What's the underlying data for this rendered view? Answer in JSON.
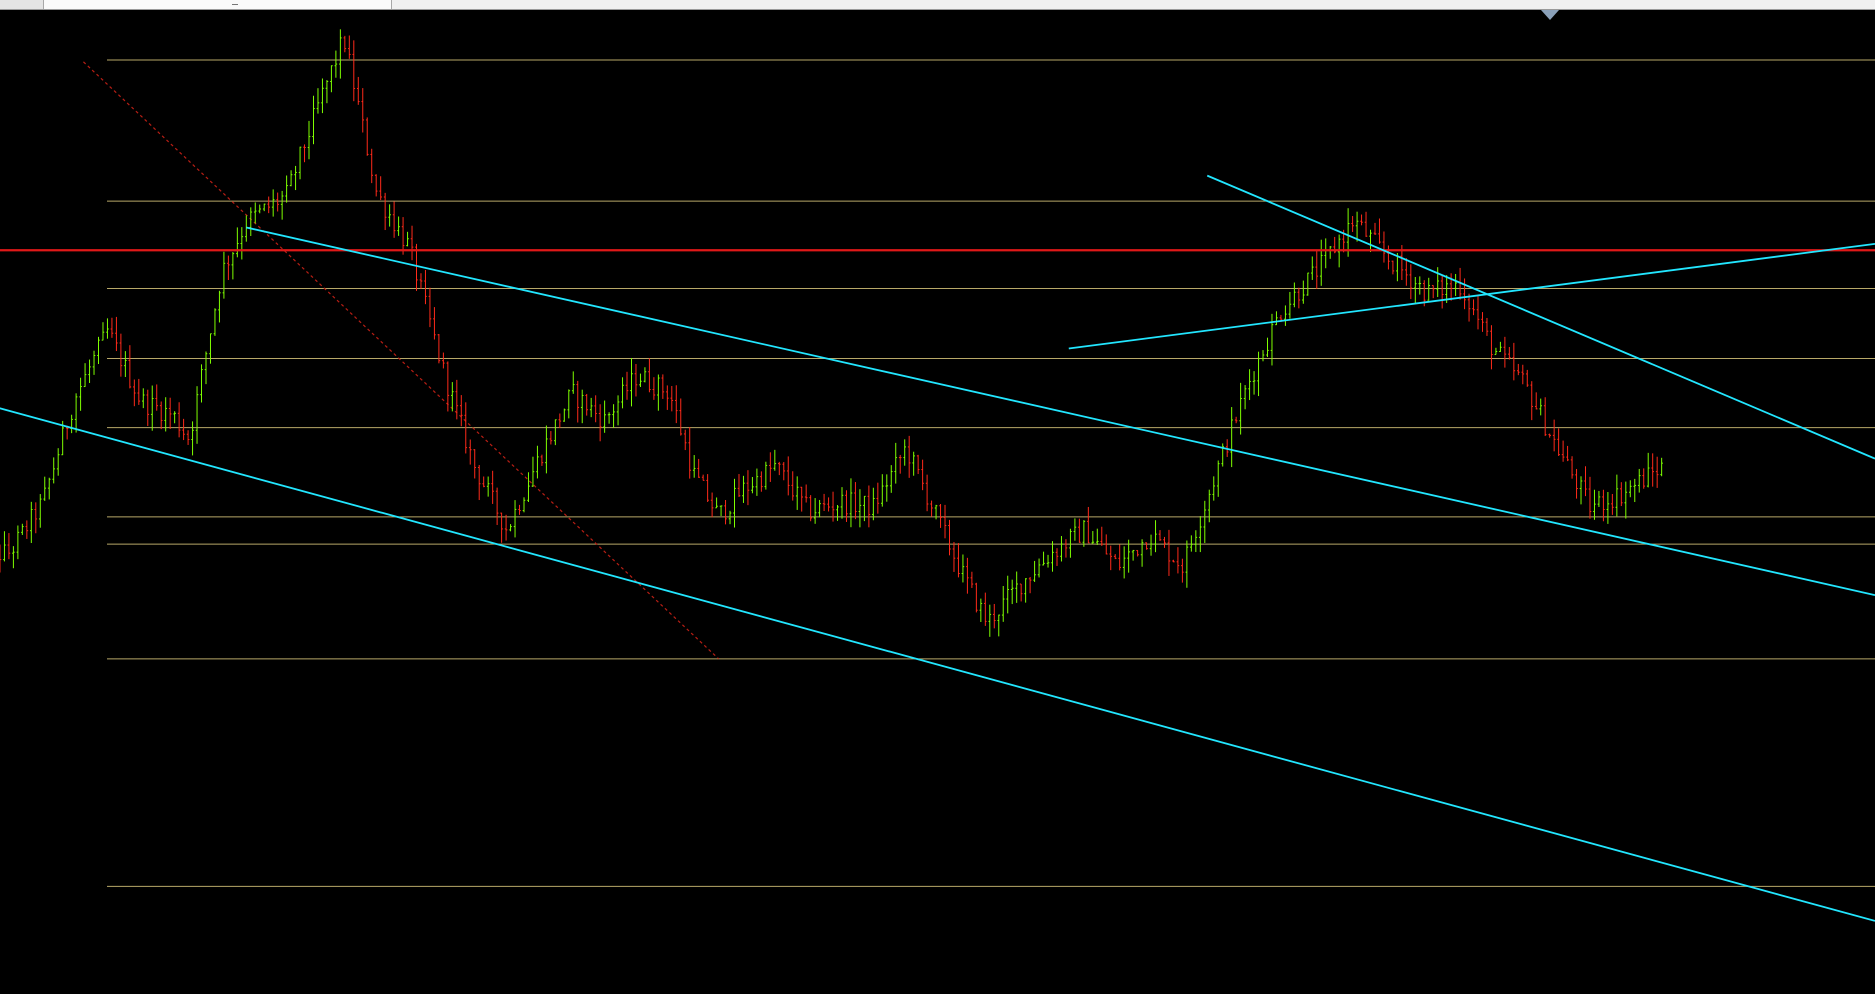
{
  "window": {
    "tabs": [
      "",
      ""
    ],
    "background": "#000000"
  },
  "colors": {
    "bull_candle": "#7fff00",
    "bear_candle": "#ff2a1a",
    "level_line": "#b8a868",
    "trendline": "#22e6ff",
    "key_level": "#e01818",
    "dashed_diagonal": "#b81e14"
  },
  "icons": {
    "scroll_marker": "down-triangle-icon"
  },
  "chart_data": {
    "type": "candlestick",
    "title": "",
    "xlabel": "",
    "ylabel": "",
    "grid": false,
    "legend": "none",
    "ylim": [
      0,
      100
    ],
    "horizontal_levels": [
      95.6,
      80.1,
      70.5,
      62.8,
      55.2,
      45.4,
      42.4,
      29.8,
      4.8
    ],
    "key_level": 74.7,
    "trendlines": [
      {
        "name": "",
        "points": [
          [
            -3,
            58
          ],
          [
            230,
            1
          ]
        ]
      },
      {
        "name": "",
        "points": [
          [
            30,
            77.2
          ],
          [
            230,
            36.8
          ]
        ]
      },
      {
        "name": "",
        "points": [
          [
            131,
            63.9
          ],
          [
            230,
            75.4
          ]
        ]
      },
      {
        "name": "",
        "points": [
          [
            148,
            82.9
          ],
          [
            230,
            51.8
          ]
        ]
      }
    ],
    "dashed_lines": [
      {
        "name": "",
        "points": [
          [
            10,
            95.4
          ],
          [
            88,
            29.8
          ]
        ]
      }
    ],
    "series": [
      {
        "name": "",
        "points": [
          [
            -3,
            41.0
          ],
          [
            1,
            41.5
          ],
          [
            5,
            47.0
          ],
          [
            9,
            58.6
          ],
          [
            13,
            65.8
          ],
          [
            17,
            58.2
          ],
          [
            21,
            56.6
          ],
          [
            23,
            54.0
          ],
          [
            27,
            72.3
          ],
          [
            30,
            77.8
          ],
          [
            35,
            80.8
          ],
          [
            39,
            91.0
          ],
          [
            42,
            98.0
          ],
          [
            46,
            81.0
          ],
          [
            50,
            75.0
          ],
          [
            54,
            62.0
          ],
          [
            58,
            51.0
          ],
          [
            62,
            44.0
          ],
          [
            66,
            52.0
          ],
          [
            70,
            59.0
          ],
          [
            74,
            56.0
          ],
          [
            78,
            61.0
          ],
          [
            82,
            59.0
          ],
          [
            85,
            50.0
          ],
          [
            88,
            45.5
          ],
          [
            91,
            48.4
          ],
          [
            95,
            51.0
          ],
          [
            99,
            46.0
          ],
          [
            103,
            47.0
          ],
          [
            107,
            46.5
          ],
          [
            111,
            53.0
          ],
          [
            115,
            45.0
          ],
          [
            118,
            39.0
          ],
          [
            121,
            33.8
          ],
          [
            125,
            38.0
          ],
          [
            129,
            41.5
          ],
          [
            133,
            44.0
          ],
          [
            137,
            40.0
          ],
          [
            141,
            43.5
          ],
          [
            145,
            40.0
          ],
          [
            149,
            50.0
          ],
          [
            153,
            60.0
          ],
          [
            157,
            68.0
          ],
          [
            162,
            73.0
          ],
          [
            166,
            78.0
          ],
          [
            170,
            74.0
          ],
          [
            175,
            70.0
          ],
          [
            179,
            71.0
          ],
          [
            183,
            64.0
          ],
          [
            187,
            60.0
          ],
          [
            191,
            53.0
          ],
          [
            195,
            46.5
          ],
          [
            199,
            48.0
          ],
          [
            204,
            51.0
          ]
        ]
      }
    ]
  }
}
